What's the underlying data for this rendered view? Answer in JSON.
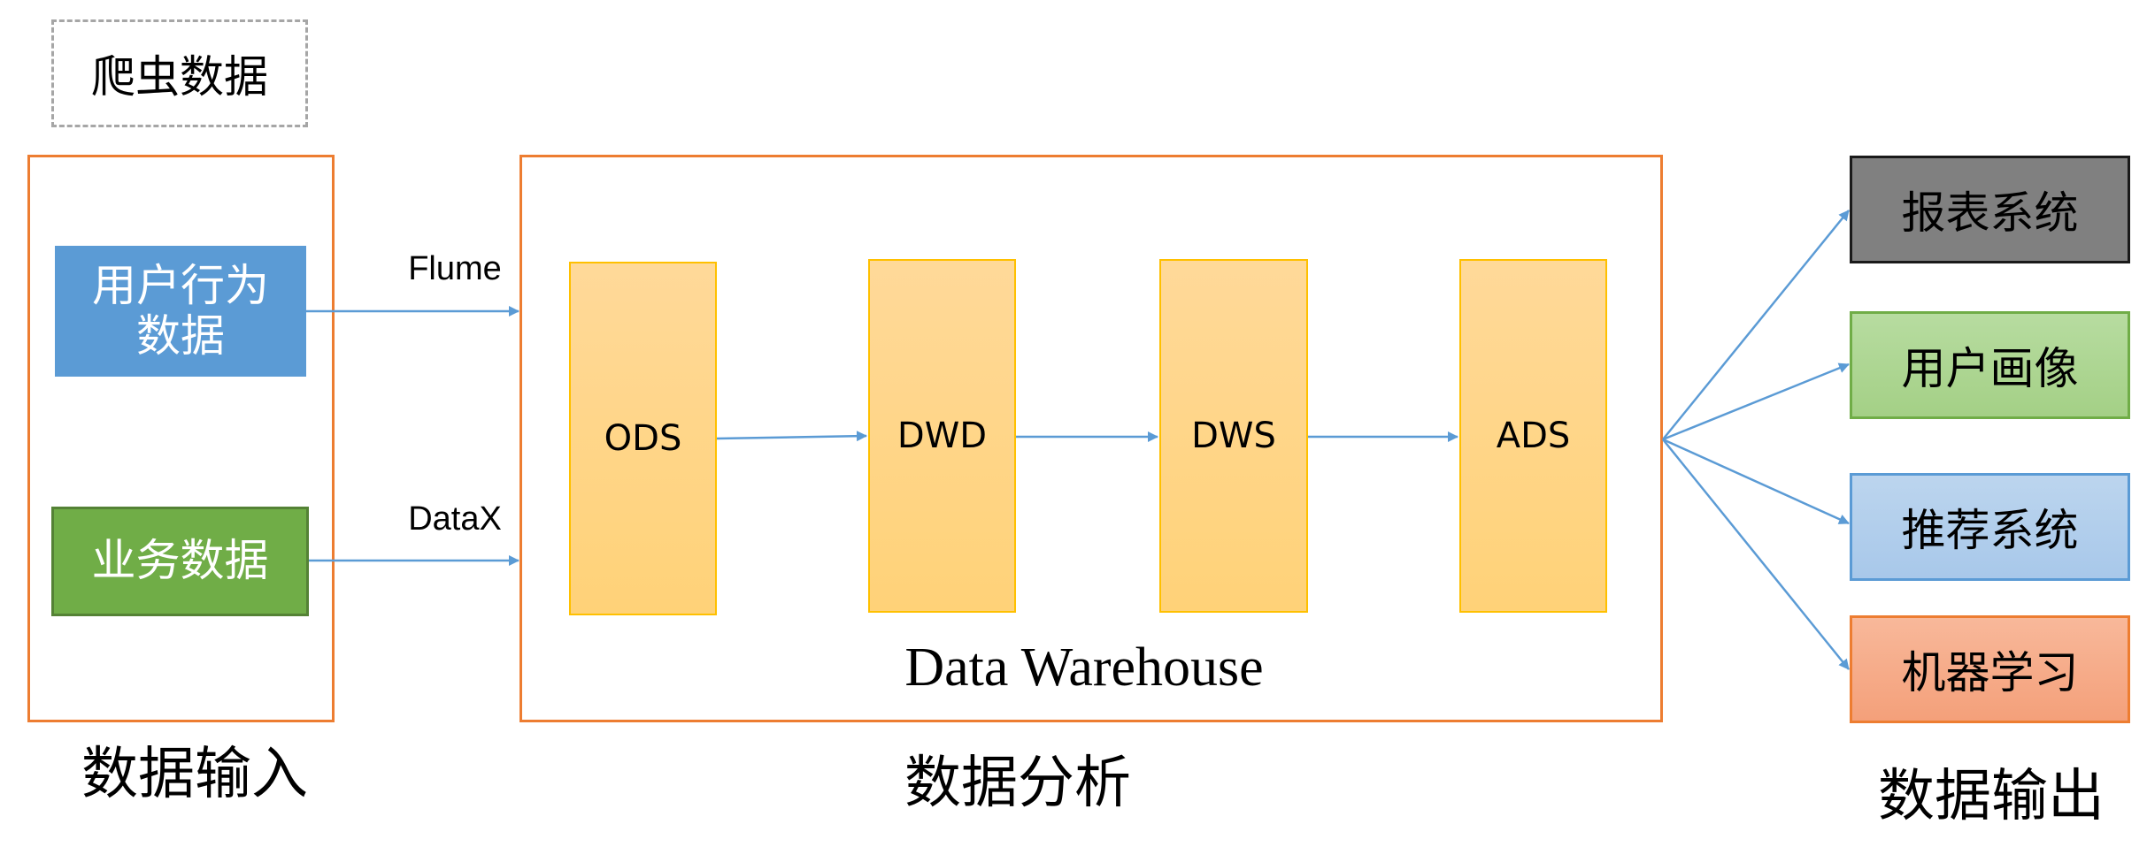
{
  "crawler": "爬虫数据",
  "sources": {
    "user_behavior": "用户行为\n数据",
    "business": "业务数据"
  },
  "tools": {
    "flume": "Flume",
    "datax": "DataX"
  },
  "layers": [
    "ODS",
    "DWD",
    "DWS",
    "ADS"
  ],
  "warehouse_label": "Data Warehouse",
  "outputs": [
    "报表系统",
    "用户画像",
    "推荐系统",
    "机器学习"
  ],
  "sections": {
    "input": "数据输入",
    "analysis": "数据分析",
    "output": "数据输出"
  },
  "colors": {
    "frame": "#ed7d31",
    "arrow": "#5b9bd5",
    "user_behavior": "#5b9bd5",
    "business": "#70ad47",
    "layer": "#ffd278",
    "report": "#808080",
    "portrait": "#a9d18e",
    "recommend": "#a8c8ea",
    "ml": "#f4a07a"
  }
}
